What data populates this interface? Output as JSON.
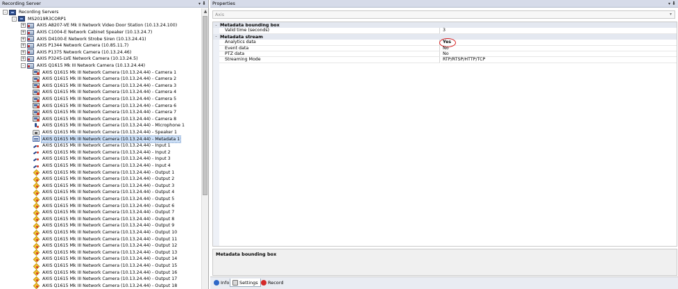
{
  "left_pane": {
    "title": "Recording Server",
    "pin": "⬇",
    "tree": [
      {
        "label": "Recording Servers",
        "icon": "servers-icon",
        "expander": "-",
        "level": 0
      },
      {
        "label": "MS2019R3CORP1",
        "icon": "server-icon",
        "expander": "-",
        "level": 1
      },
      {
        "label": "AXIS A8207-VE Mk II Network Video Door Station (10.13.24.100)",
        "icon": "camera-device-icon",
        "expander": "+",
        "level": 2
      },
      {
        "label": "AXIS C1004-E Network Cabinet Speaker (10.13.24.7)",
        "icon": "camera-device-icon",
        "expander": "+",
        "level": 2
      },
      {
        "label": "AXIS D4100-E Network Strobe Siren (10.13.24.41)",
        "icon": "camera-device-icon",
        "expander": "+",
        "level": 2
      },
      {
        "label": "AXIS P1344 Network Camera (10.85.11.7)",
        "icon": "camera-device-icon",
        "expander": "+",
        "level": 2
      },
      {
        "label": "AXIS P1375 Network Camera (10.13.24.46)",
        "icon": "camera-device-icon",
        "expander": "+",
        "level": 2
      },
      {
        "label": "AXIS P3245-LVE Network Camera (10.13.24.5)",
        "icon": "camera-device-icon",
        "expander": "+",
        "level": 2
      },
      {
        "label": "AXIS Q1615 Mk III Network Camera (10.13.24.44)",
        "icon": "camera-device-icon",
        "expander": "-",
        "level": 2
      },
      {
        "label": "AXIS Q1615 Mk III Network Camera (10.13.24.44) - Camera 1",
        "icon": "camera-channel-icon",
        "level": 3
      },
      {
        "label": "AXIS Q1615 Mk III Network Camera (10.13.24.44) - Camera 2",
        "icon": "camera-channel-icon",
        "level": 3
      },
      {
        "label": "AXIS Q1615 Mk III Network Camera (10.13.24.44) - Camera 3",
        "icon": "camera-channel-icon",
        "level": 3
      },
      {
        "label": "AXIS Q1615 Mk III Network Camera (10.13.24.44) - Camera 4",
        "icon": "camera-channel-icon",
        "level": 3
      },
      {
        "label": "AXIS Q1615 Mk III Network Camera (10.13.24.44) - Camera 5",
        "icon": "camera-channel-icon",
        "level": 3
      },
      {
        "label": "AXIS Q1615 Mk III Network Camera (10.13.24.44) - Camera 6",
        "icon": "camera-channel-icon",
        "level": 3
      },
      {
        "label": "AXIS Q1615 Mk III Network Camera (10.13.24.44) - Camera 7",
        "icon": "camera-channel-icon",
        "level": 3
      },
      {
        "label": "AXIS Q1615 Mk III Network Camera (10.13.24.44) - Camera 8",
        "icon": "camera-channel-icon",
        "level": 3
      },
      {
        "label": "AXIS Q1615 Mk III Network Camera (10.13.24.44) - Microphone 1",
        "icon": "microphone-icon",
        "level": 3
      },
      {
        "label": "AXIS Q1615 Mk III Network Camera (10.13.24.44) - Speaker 1",
        "icon": "speaker-icon",
        "level": 3
      },
      {
        "label": "AXIS Q1615 Mk III Network Camera (10.13.24.44) - Metadata 1",
        "icon": "metadata-icon",
        "level": 3,
        "selected": true
      },
      {
        "label": "AXIS Q1615 Mk III Network Camera (10.13.24.44) - Input 1",
        "icon": "input-icon",
        "level": 3
      },
      {
        "label": "AXIS Q1615 Mk III Network Camera (10.13.24.44) - Input 2",
        "icon": "input-icon",
        "level": 3
      },
      {
        "label": "AXIS Q1615 Mk III Network Camera (10.13.24.44) - Input 3",
        "icon": "input-icon",
        "level": 3
      },
      {
        "label": "AXIS Q1615 Mk III Network Camera (10.13.24.44) - Input 4",
        "icon": "input-icon",
        "level": 3
      },
      {
        "label": "AXIS Q1615 Mk III Network Camera (10.13.24.44) - Output 1",
        "icon": "output-icon",
        "level": 3
      },
      {
        "label": "AXIS Q1615 Mk III Network Camera (10.13.24.44) - Output 2",
        "icon": "output-icon",
        "level": 3
      },
      {
        "label": "AXIS Q1615 Mk III Network Camera (10.13.24.44) - Output 3",
        "icon": "output-icon",
        "level": 3
      },
      {
        "label": "AXIS Q1615 Mk III Network Camera (10.13.24.44) - Output 4",
        "icon": "output-icon",
        "level": 3
      },
      {
        "label": "AXIS Q1615 Mk III Network Camera (10.13.24.44) - Output 5",
        "icon": "output-icon",
        "level": 3
      },
      {
        "label": "AXIS Q1615 Mk III Network Camera (10.13.24.44) - Output 6",
        "icon": "output-icon",
        "level": 3
      },
      {
        "label": "AXIS Q1615 Mk III Network Camera (10.13.24.44) - Output 7",
        "icon": "output-icon",
        "level": 3
      },
      {
        "label": "AXIS Q1615 Mk III Network Camera (10.13.24.44) - Output 8",
        "icon": "output-icon",
        "level": 3
      },
      {
        "label": "AXIS Q1615 Mk III Network Camera (10.13.24.44) - Output 9",
        "icon": "output-icon",
        "level": 3
      },
      {
        "label": "AXIS Q1615 Mk III Network Camera (10.13.24.44) - Output 10",
        "icon": "output-icon",
        "level": 3
      },
      {
        "label": "AXIS Q1615 Mk III Network Camera (10.13.24.44) - Output 11",
        "icon": "output-icon",
        "level": 3
      },
      {
        "label": "AXIS Q1615 Mk III Network Camera (10.13.24.44) - Output 12",
        "icon": "output-icon",
        "level": 3
      },
      {
        "label": "AXIS Q1615 Mk III Network Camera (10.13.24.44) - Output 13",
        "icon": "output-icon",
        "level": 3
      },
      {
        "label": "AXIS Q1615 Mk III Network Camera (10.13.24.44) - Output 14",
        "icon": "output-icon",
        "level": 3
      },
      {
        "label": "AXIS Q1615 Mk III Network Camera (10.13.24.44) - Output 15",
        "icon": "output-icon",
        "level": 3
      },
      {
        "label": "AXIS Q1615 Mk III Network Camera (10.13.24.44) - Output 16",
        "icon": "output-icon",
        "level": 3
      },
      {
        "label": "AXIS Q1615 Mk III Network Camera (10.13.24.44) - Output 17",
        "icon": "output-icon",
        "level": 3
      },
      {
        "label": "AXIS Q1615 Mk III Network Camera (10.13.24.44) - Output 18",
        "icon": "output-icon",
        "level": 3
      }
    ]
  },
  "right_pane": {
    "title": "Properties",
    "pin": "⬇",
    "device_combo": "Axis",
    "categories": [
      {
        "title": "Metadata bounding box",
        "expander": "-",
        "items": [
          {
            "name": "Valid time (seconds)",
            "value": "3"
          }
        ]
      },
      {
        "title": "Metadata stream",
        "expander": "-",
        "items": [
          {
            "name": "Analytics data",
            "value": "Yes",
            "bold": true,
            "highlighted": true
          },
          {
            "name": "Event data",
            "value": "No"
          },
          {
            "name": "PTZ data",
            "value": "No"
          },
          {
            "name": "Streaming Mode",
            "value": "RTP/RTSP/HTTP/TCP"
          }
        ]
      }
    ],
    "description_title": "Metadata bounding box",
    "tabs": [
      {
        "label": "Info",
        "icon": "info-icon"
      },
      {
        "label": "Settings",
        "icon": "settings-icon",
        "active": true
      },
      {
        "label": "Record",
        "icon": "record-icon"
      }
    ]
  },
  "colors": {
    "header_bg": "#d6dbe9",
    "selection_bg": "#cde0f7",
    "highlight_circle": "#d81f1f",
    "category_bg": "#e4e8f0"
  }
}
